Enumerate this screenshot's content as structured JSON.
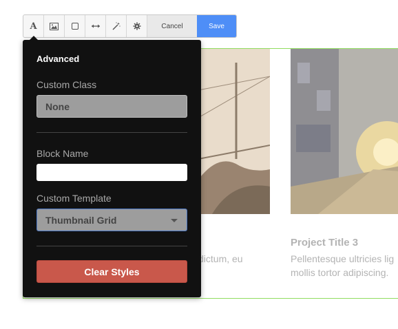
{
  "toolbar": {
    "tools": [
      {
        "icon": "text-format-icon",
        "label": "A"
      },
      {
        "icon": "image-icon"
      },
      {
        "icon": "box-icon"
      },
      {
        "icon": "resize-horizontal-icon"
      },
      {
        "icon": "magic-wand-icon"
      },
      {
        "icon": "gear-icon"
      }
    ],
    "cancel_label": "Cancel",
    "save_label": "Save"
  },
  "panel": {
    "title": "Advanced",
    "custom_class": {
      "label": "Custom Class",
      "value": "None"
    },
    "block_name": {
      "label": "Block Name",
      "value": ""
    },
    "custom_template": {
      "label": "Custom Template",
      "value": "Thumbnail Grid"
    },
    "clear_label": "Clear Styles"
  },
  "background": {
    "left_text": "dictum, eu",
    "project_title": "Project Title 3",
    "project_text_1": "Pellentesque ultricies lig",
    "project_text_2": "mollis tortor adipiscing."
  },
  "colors": {
    "save": "#4e8ef7",
    "panel": "#111111",
    "clear": "#c9584b",
    "frame": "#8fdc5e"
  }
}
